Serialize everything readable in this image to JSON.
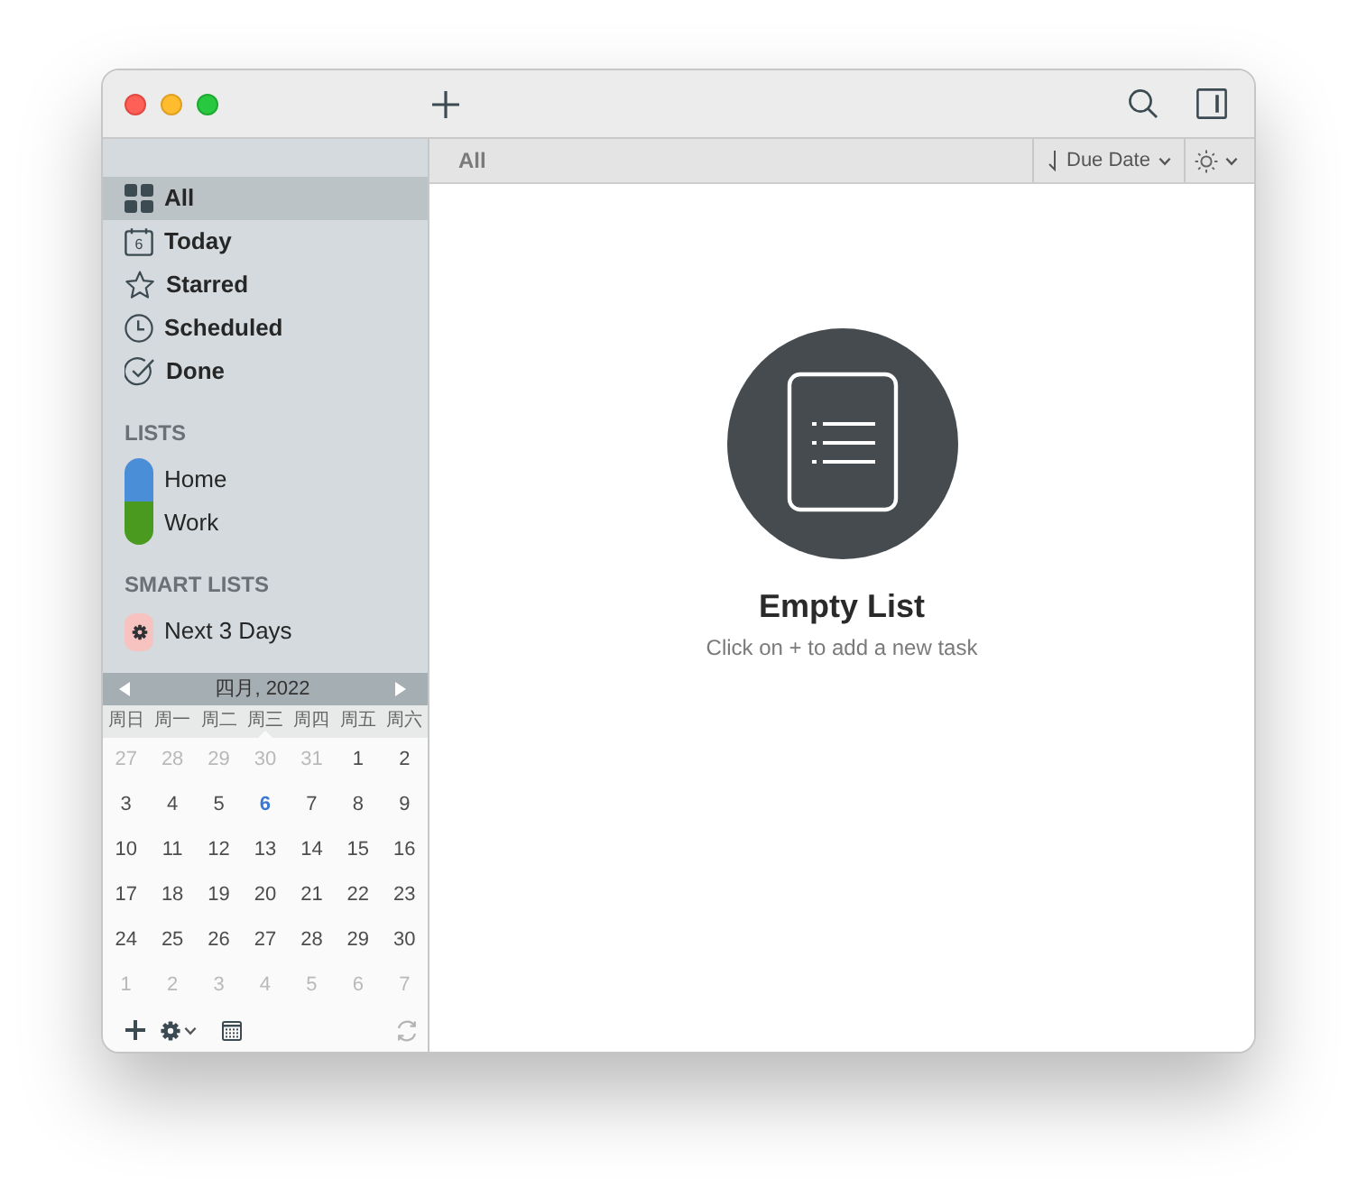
{
  "sidebar": {
    "items": [
      {
        "kind": "all",
        "label": "All",
        "selected": true
      },
      {
        "kind": "today",
        "label": "Today",
        "icon_text": "6",
        "selected": false
      },
      {
        "kind": "starred",
        "label": "Starred",
        "selected": false
      },
      {
        "kind": "scheduled",
        "label": "Scheduled",
        "selected": false
      },
      {
        "kind": "done",
        "label": "Done",
        "selected": false
      }
    ],
    "lists": {
      "header": "LISTS",
      "items": [
        {
          "label": "Home",
          "color": "#4a8ed7",
          "selected": false
        },
        {
          "label": "Work",
          "color": "#4a9a1f",
          "selected": false
        }
      ]
    },
    "smart_lists": {
      "header": "SMART LISTS",
      "items": [
        {
          "label": "Next 3 Days",
          "color": "#f6c3c1",
          "selected": false
        }
      ]
    }
  },
  "calendar": {
    "month": "四月, 2022",
    "weekdays": [
      "周日",
      "周一",
      "周二",
      "周三",
      "周四",
      "周五",
      "周六"
    ],
    "days": [
      {
        "day": "27",
        "in_month": false,
        "today": false
      },
      {
        "day": "28",
        "in_month": false,
        "today": false
      },
      {
        "day": "29",
        "in_month": false,
        "today": false
      },
      {
        "day": "30",
        "in_month": false,
        "today": false
      },
      {
        "day": "31",
        "in_month": false,
        "today": false
      },
      {
        "day": "1",
        "in_month": true,
        "today": false
      },
      {
        "day": "2",
        "in_month": true,
        "today": false
      },
      {
        "day": "3",
        "in_month": true,
        "today": false
      },
      {
        "day": "4",
        "in_month": true,
        "today": false
      },
      {
        "day": "5",
        "in_month": true,
        "today": false
      },
      {
        "day": "6",
        "in_month": true,
        "today": true
      },
      {
        "day": "7",
        "in_month": true,
        "today": false
      },
      {
        "day": "8",
        "in_month": true,
        "today": false
      },
      {
        "day": "9",
        "in_month": true,
        "today": false
      },
      {
        "day": "10",
        "in_month": true,
        "today": false
      },
      {
        "day": "11",
        "in_month": true,
        "today": false
      },
      {
        "day": "12",
        "in_month": true,
        "today": false
      },
      {
        "day": "13",
        "in_month": true,
        "today": false
      },
      {
        "day": "14",
        "in_month": true,
        "today": false
      },
      {
        "day": "15",
        "in_month": true,
        "today": false
      },
      {
        "day": "16",
        "in_month": true,
        "today": false
      },
      {
        "day": "17",
        "in_month": true,
        "today": false
      },
      {
        "day": "18",
        "in_month": true,
        "today": false
      },
      {
        "day": "19",
        "in_month": true,
        "today": false
      },
      {
        "day": "20",
        "in_month": true,
        "today": false
      },
      {
        "day": "21",
        "in_month": true,
        "today": false
      },
      {
        "day": "22",
        "in_month": true,
        "today": false
      },
      {
        "day": "23",
        "in_month": true,
        "today": false
      },
      {
        "day": "24",
        "in_month": true,
        "today": false
      },
      {
        "day": "25",
        "in_month": true,
        "today": false
      },
      {
        "day": "26",
        "in_month": true,
        "today": false
      },
      {
        "day": "27",
        "in_month": true,
        "today": false
      },
      {
        "day": "28",
        "in_month": true,
        "today": false
      },
      {
        "day": "29",
        "in_month": true,
        "today": false
      },
      {
        "day": "30",
        "in_month": true,
        "today": false
      },
      {
        "day": "1",
        "in_month": false,
        "today": false
      },
      {
        "day": "2",
        "in_month": false,
        "today": false
      },
      {
        "day": "3",
        "in_month": false,
        "today": false
      },
      {
        "day": "4",
        "in_month": false,
        "today": false
      },
      {
        "day": "5",
        "in_month": false,
        "today": false
      },
      {
        "day": "6",
        "in_month": false,
        "today": false
      },
      {
        "day": "7",
        "in_month": false,
        "today": false
      }
    ]
  },
  "main": {
    "header": {
      "title": "All",
      "sort": "Due Date"
    },
    "empty_state": {
      "title": "Empty List",
      "hint": "Click on + to add a new task"
    }
  }
}
